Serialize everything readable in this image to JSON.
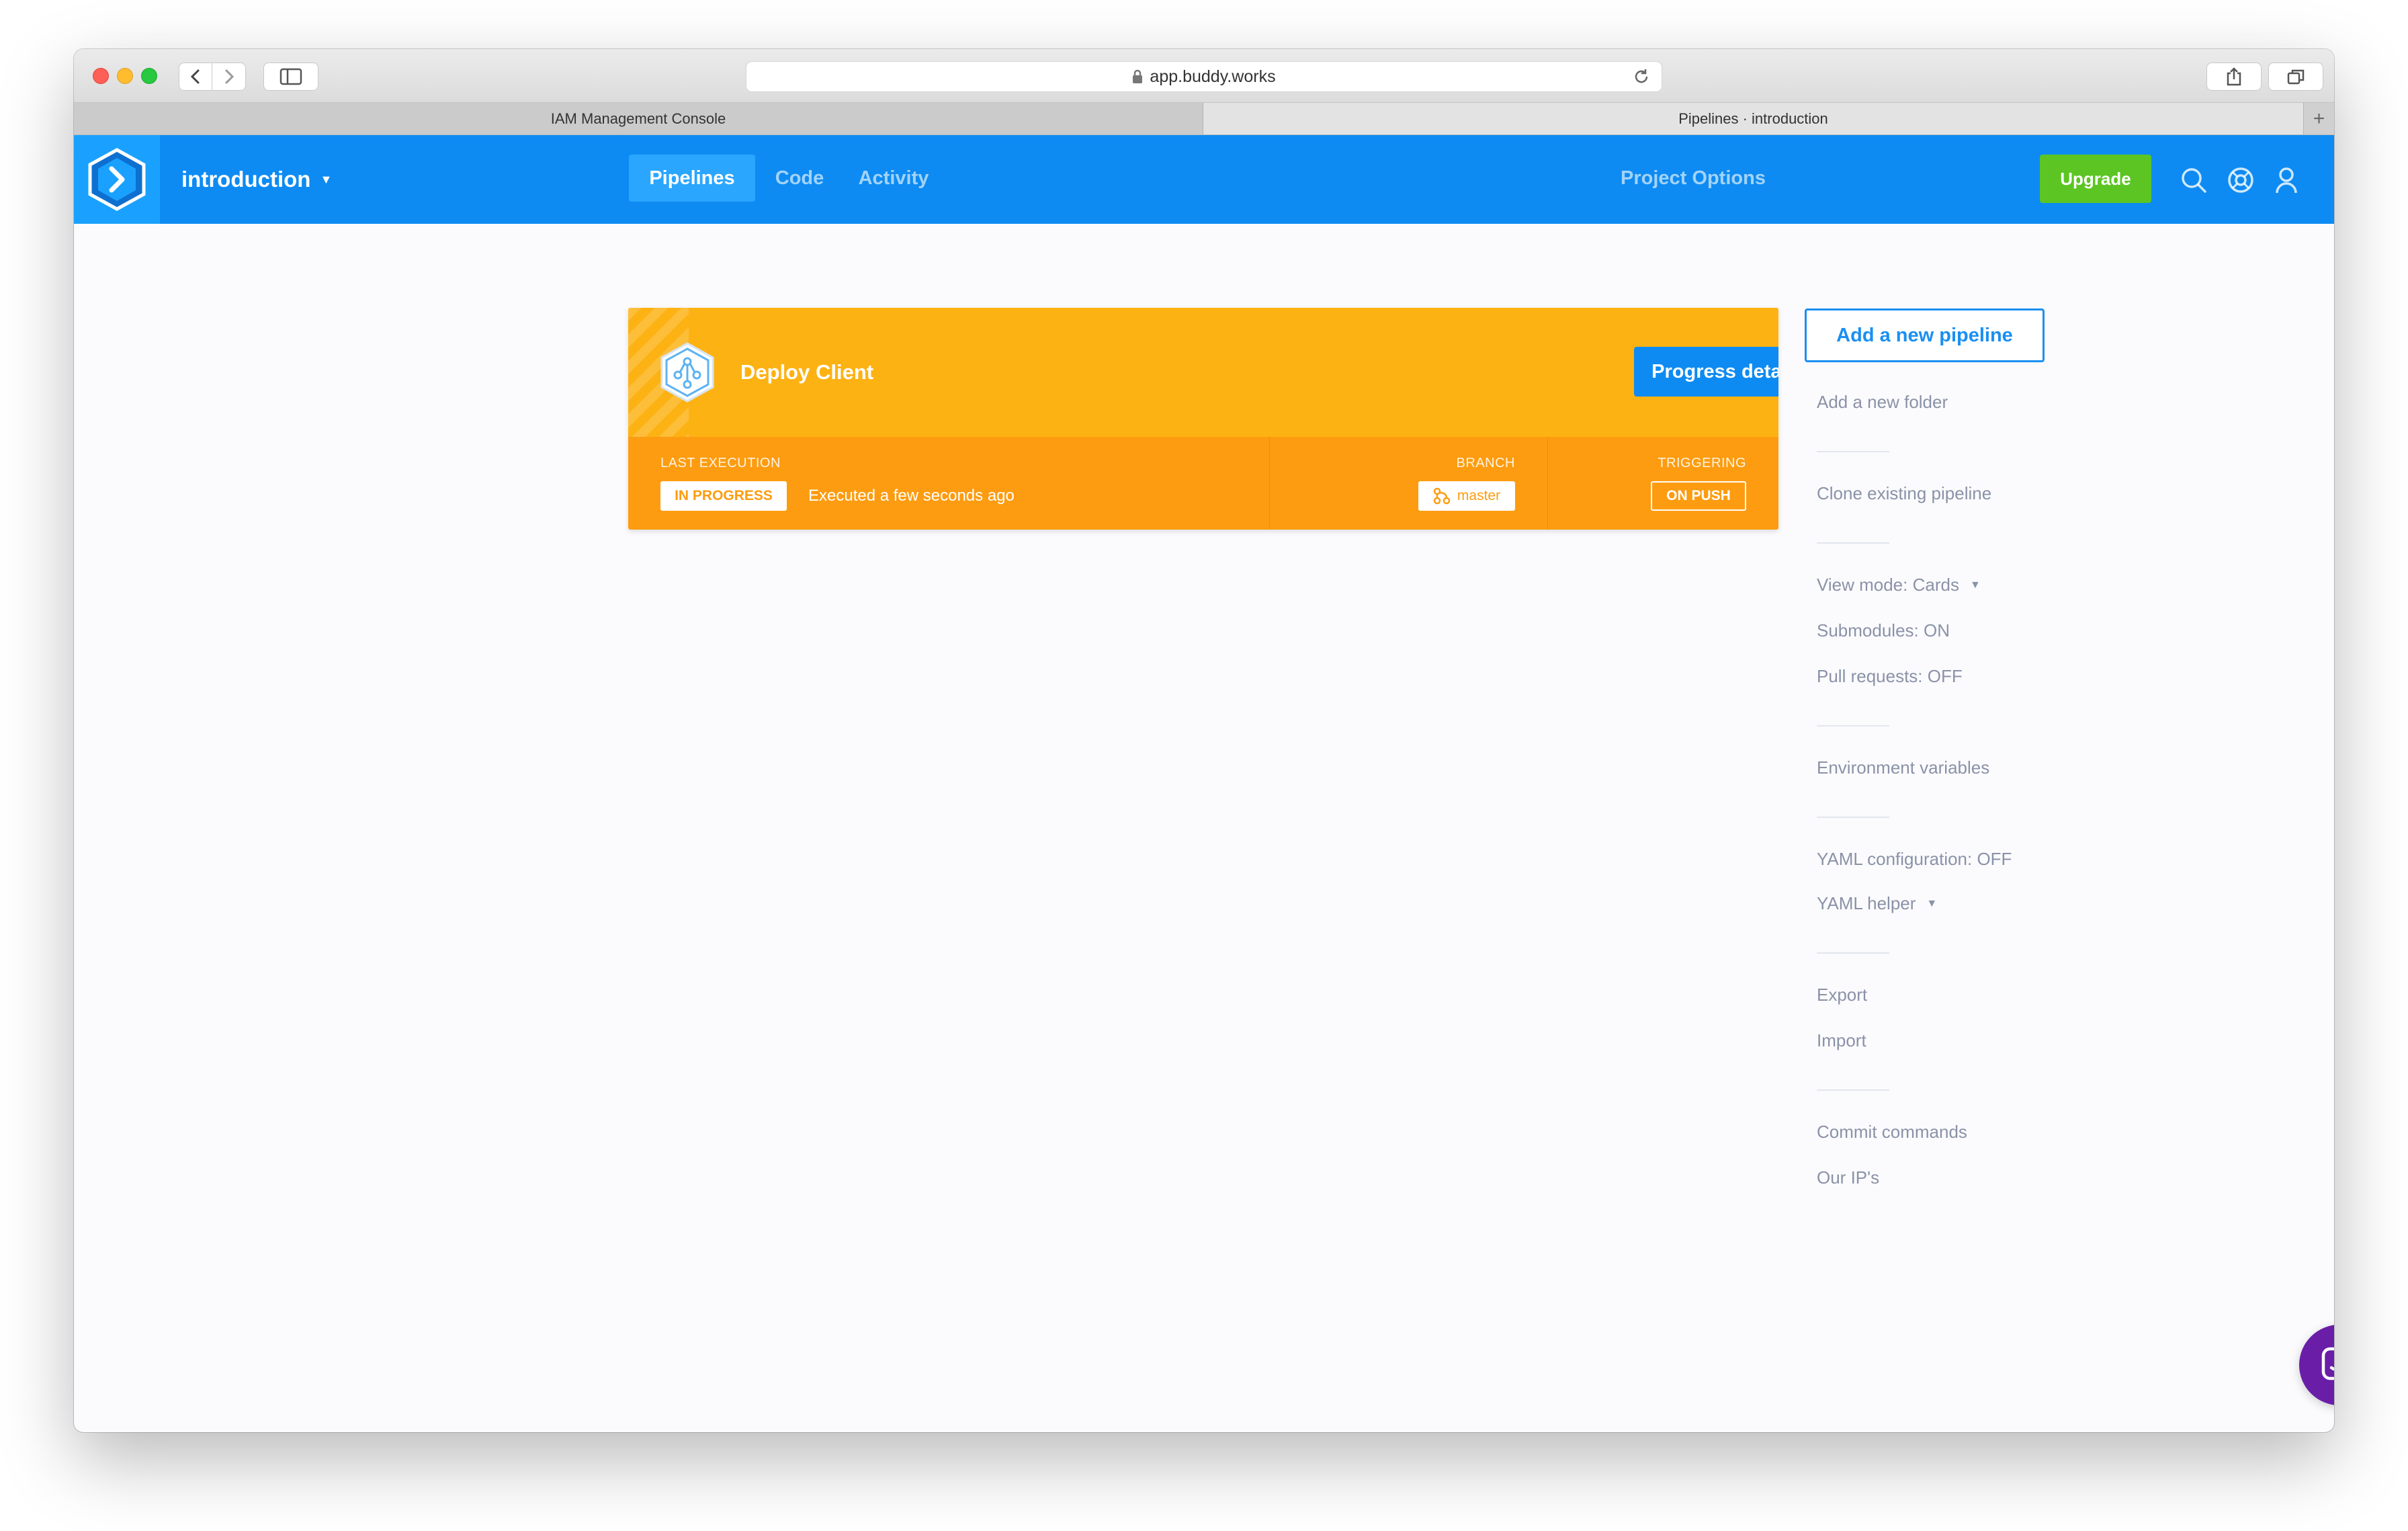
{
  "browser": {
    "url": "app.buddy.works",
    "tabs": [
      {
        "label": "IAM Management Console"
      },
      {
        "label": "Pipelines · introduction"
      }
    ],
    "new_tab_label": "+"
  },
  "header": {
    "project_name": "introduction",
    "nav": {
      "pipelines": "Pipelines",
      "code": "Code",
      "activity": "Activity",
      "project_options": "Project Options"
    },
    "upgrade_label": "Upgrade",
    "icons": [
      "search-icon",
      "help-icon",
      "user-icon"
    ]
  },
  "pipeline_card": {
    "name": "Deploy Client",
    "progress_button": "Progress details",
    "last_execution_label": "LAST EXECUTION",
    "status_badge": "IN PROGRESS",
    "executed_text": "Executed a few seconds ago",
    "branch_label": "BRANCH",
    "branch_value": "master",
    "triggering_label": "TRIGGERING",
    "triggering_value": "ON PUSH"
  },
  "sidebar": {
    "add_pipeline": "Add a new pipeline",
    "add_folder": "Add a new folder",
    "clone_pipeline": "Clone existing pipeline",
    "view_mode": "View mode: Cards",
    "submodules": "Submodules: ON",
    "pull_requests": "Pull requests: OFF",
    "env_variables": "Environment variables",
    "yaml_config": "YAML configuration: OFF",
    "yaml_helper": "YAML helper",
    "export": "Export",
    "import": "Import",
    "commit_commands": "Commit commands",
    "our_ips": "Our IP's"
  },
  "colors": {
    "brand_blue": "#0d8bf2",
    "card_yellow": "#fdb214",
    "card_orange": "#fd9c10",
    "upgrade_green": "#5cc523",
    "chat_purple": "#6a1ea7"
  }
}
